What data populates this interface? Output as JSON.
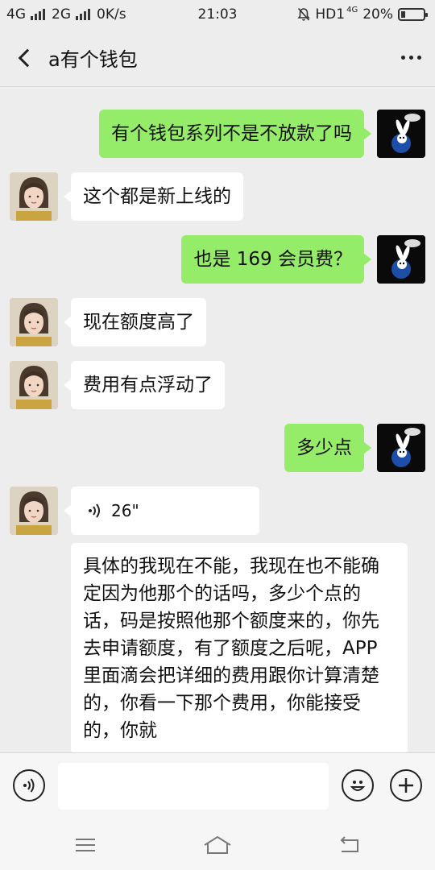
{
  "status_bar": {
    "net1": "4G",
    "net2": "2G",
    "speed": "0K/s",
    "time": "21:03",
    "hd": "HD1",
    "net3": "4G",
    "battery": "20%",
    "battery_level": 0.2
  },
  "header": {
    "title": "a有个钱包",
    "back_icon": "chevron-left-icon",
    "more_icon": "more-horizontal-icon"
  },
  "messages": [
    {
      "side": "me",
      "text": "有个钱包系列不是不放款了吗"
    },
    {
      "side": "her",
      "text": "这个都是新上线的"
    },
    {
      "side": "me",
      "text": "也是 169 会员费？"
    },
    {
      "side": "her",
      "text": "现在额度高了"
    },
    {
      "side": "her",
      "text": "费用有点浮动了"
    },
    {
      "side": "me",
      "text": "多少点"
    },
    {
      "side": "her",
      "type": "voice",
      "text": "26\""
    },
    {
      "side": "her",
      "text": "具体的我现在不能，我现在也不能确定因为他那个的话吗，多少个点的话，码是按照他那个额度来的，你先去申请额度，有了额度之后呢，APP 里面滴会把详细的费用跟你计算清楚的，你看一下那个费用，你能接受的，你就"
    }
  ],
  "input_bar": {
    "voice_icon": "voice-input-icon",
    "emoji_icon": "emoji-icon",
    "plus_icon": "plus-icon"
  },
  "nav_bar": {
    "menu_icon": "menu-icon",
    "home_icon": "home-icon",
    "back_icon": "back-icon"
  },
  "colors": {
    "sent_bubble": "#95ec69",
    "received_bubble": "#ffffff",
    "background": "#ededed"
  }
}
